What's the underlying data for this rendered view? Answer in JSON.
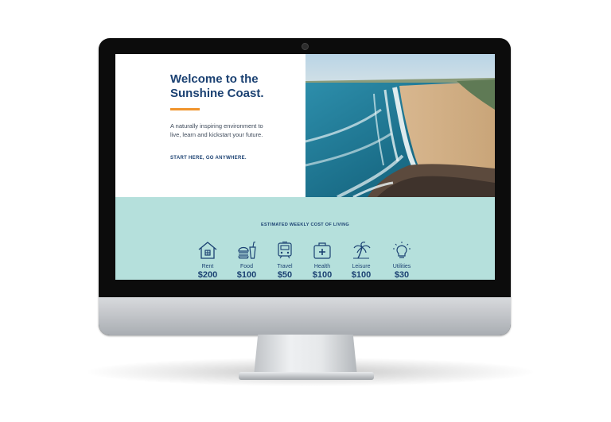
{
  "hero": {
    "title": "Welcome to the Sunshine Coast.",
    "description": "A naturally inspiring environment to live, learn and kickstart your future.",
    "cta_label": "START HERE, GO ANYWHERE.",
    "accent_color": "#f0942c",
    "title_color": "#1b4172"
  },
  "cost_of_living": {
    "heading": "ESTIMATED WEEKLY COST OF LIVING",
    "background_color": "#b5e0dc",
    "categories": [
      {
        "label": "Rent",
        "price": "$200",
        "icon": "house-icon"
      },
      {
        "label": "Food",
        "price": "$100",
        "icon": "burger-drink-icon"
      },
      {
        "label": "Travel",
        "price": "$50",
        "icon": "train-icon"
      },
      {
        "label": "Health",
        "price": "$100",
        "icon": "first-aid-kit-icon"
      },
      {
        "label": "Leisure",
        "price": "$100",
        "icon": "palm-tree-icon"
      },
      {
        "label": "Utilities",
        "price": "$30",
        "icon": "lightbulb-icon"
      }
    ]
  }
}
